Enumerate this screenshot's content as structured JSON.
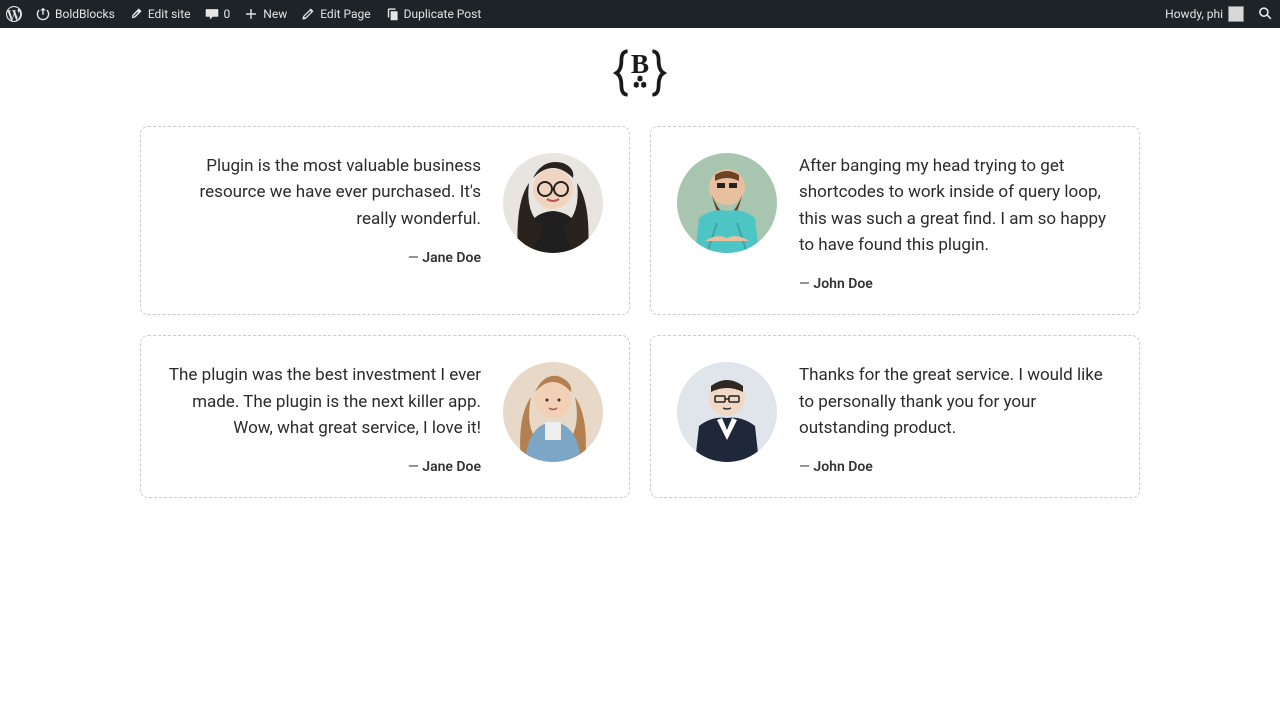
{
  "adminbar": {
    "site_name": "BoldBlocks",
    "edit_site": "Edit site",
    "comment_count": "0",
    "new": "New",
    "edit_page": "Edit Page",
    "duplicate_post": "Duplicate Post",
    "howdy": "Howdy, phi"
  },
  "testimonials": [
    {
      "quote": "Plugin is the most valuable business resource we have ever purchased. It's really wonderful.",
      "author": "Jane Doe",
      "layout": "left"
    },
    {
      "quote": "After banging my head trying to get shortcodes to work inside of query loop, this was such a great find. I am so happy to have found this plugin.",
      "author": "John Doe",
      "layout": "right"
    },
    {
      "quote": "The plugin was the best investment I ever made. The plugin is the next killer app. Wow, what great service, I love it!",
      "author": "Jane Doe",
      "layout": "left"
    },
    {
      "quote": "Thanks for the great service. I would like to personally thank you for your outstanding product.",
      "author": "John Doe",
      "layout": "right"
    }
  ]
}
